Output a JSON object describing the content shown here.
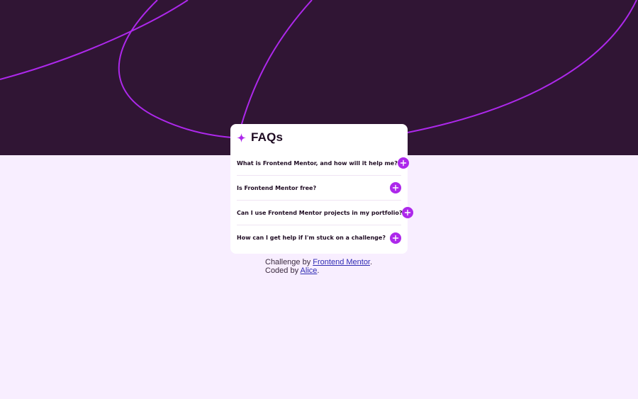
{
  "page": {
    "background": "#f8eeff",
    "hero_background": "#301534",
    "accent": "#ad28eb"
  },
  "card": {
    "title": "FAQs",
    "title_icon": "star-icon",
    "items": [
      {
        "question": "What is Frontend Mentor, and how will it help me?",
        "icon": "plus-icon"
      },
      {
        "question": "Is Frontend Mentor free?",
        "icon": "plus-icon"
      },
      {
        "question": "Can I use Frontend Mentor projects in my portfolio?",
        "icon": "plus-icon"
      },
      {
        "question": "How can I get help if I'm stuck on a challenge?",
        "icon": "plus-icon"
      }
    ]
  },
  "attribution": {
    "line1_prefix": "Challenge by ",
    "line1_link": "Frontend Mentor",
    "line1_suffix": ".",
    "line2_prefix": "Coded by ",
    "line2_link": "Alice",
    "line2_suffix": "."
  }
}
